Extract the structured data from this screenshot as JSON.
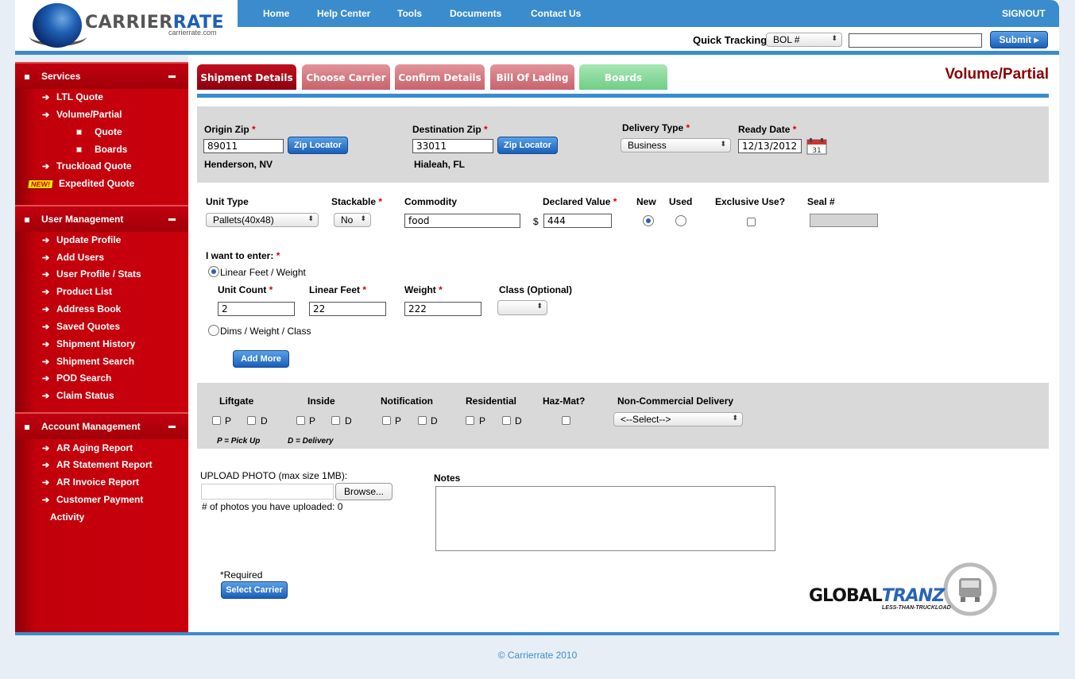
{
  "brand": {
    "name_part1": "CARRIER",
    "name_part2": "RATE",
    "sub": "carrierrate.com"
  },
  "nav": {
    "items": [
      "Home",
      "Help Center",
      "Tools",
      "Documents",
      "Contact Us"
    ],
    "signout": "SIGNOUT"
  },
  "quick_tracking": {
    "label": "Quick Tracking",
    "select_value": "BOL #",
    "input_value": "",
    "submit": "Submit"
  },
  "sidebar": {
    "services": {
      "title": "Services",
      "items": [
        "LTL Quote",
        "Volume/Partial"
      ],
      "subitems": [
        "Quote",
        "Boards"
      ],
      "items2": [
        "Truckload Quote"
      ],
      "new_badge": "NEW!",
      "expedited": "Expedited Quote"
    },
    "user_management": {
      "title": "User Management",
      "items": [
        "Update Profile",
        "Add Users",
        "User Profile / Stats",
        "Product List",
        "Address Book",
        "Saved Quotes",
        "Shipment History",
        "Shipment Search",
        "POD Search",
        "Claim Status"
      ]
    },
    "account_management": {
      "title": "Account Management",
      "items": [
        "AR Aging Report",
        "AR Statement Report",
        "AR Invoice Report",
        "Customer Payment"
      ],
      "wrap": "Activity"
    }
  },
  "tabs": [
    "Shipment Details",
    "Choose Carrier",
    "Confirm Details",
    "Bill Of Lading",
    "Boards"
  ],
  "page_title": "Volume/Partial",
  "origin": {
    "label": "Origin Zip",
    "value": "89011",
    "locator": "Zip Locator",
    "city": "Henderson, NV"
  },
  "destination": {
    "label": "Destination Zip",
    "value": "33011",
    "locator": "Zip Locator",
    "city": "Hialeah, FL"
  },
  "delivery_type": {
    "label": "Delivery Type",
    "value": "Business"
  },
  "ready_date": {
    "label": "Ready Date",
    "value": "12/13/2012"
  },
  "required_mark": "*",
  "unit": {
    "unit_type_label": "Unit Type",
    "unit_type_value": "Pallets(40x48)",
    "stackable_label": "Stackable",
    "stackable_value": "No",
    "commodity_label": "Commodity",
    "commodity_value": "food",
    "declared_label": "Declared Value",
    "currency": "$",
    "declared_value": "444",
    "new_label": "New",
    "used_label": "Used",
    "exclusive_label": "Exclusive Use?",
    "seal_label": "Seal #"
  },
  "entry": {
    "label": "I want to enter:",
    "opt1": "Linear Feet / Weight",
    "opt2": "Dims / Weight / Class",
    "unit_count_label": "Unit Count",
    "unit_count_value": "2",
    "linear_feet_label": "Linear Feet",
    "linear_feet_value": "22",
    "weight_label": "Weight",
    "weight_value": "222",
    "class_label": "Class (Optional)",
    "class_value": "",
    "add_more": "Add More"
  },
  "accessorials": {
    "liftgate": "Liftgate",
    "inside": "Inside",
    "notification": "Notification",
    "residential": "Residential",
    "hazmat": "Haz-Mat?",
    "noncommercial": "Non-Commercial Delivery",
    "noncommercial_value": "<--Select-->",
    "p": "P",
    "d": "D",
    "legend_p": "P = Pick Up",
    "legend_d": "D = Delivery"
  },
  "upload": {
    "label": "UPLOAD PHOTO (max size 1MB):",
    "browse": "Browse...",
    "count_text": "# of photos you have uploaded: 0"
  },
  "notes": {
    "label": "Notes",
    "value": ""
  },
  "required_note": "*Required",
  "select_carrier": "Select Carrier",
  "partner": {
    "name_part1": "GLOBAL",
    "name_part2": "TRANZ",
    "tagline": "LESS-THAN-TRUCKLOAD"
  },
  "footer": "© Carrierrate 2010",
  "colors": {
    "nav_blue": "#3a8ccc",
    "sidebar_red": "#c9000c",
    "title_red": "#8b0000",
    "tab_active": "#a40010",
    "tab_inactive": "#d9757d",
    "tab_boards": "#8fd9a0"
  }
}
